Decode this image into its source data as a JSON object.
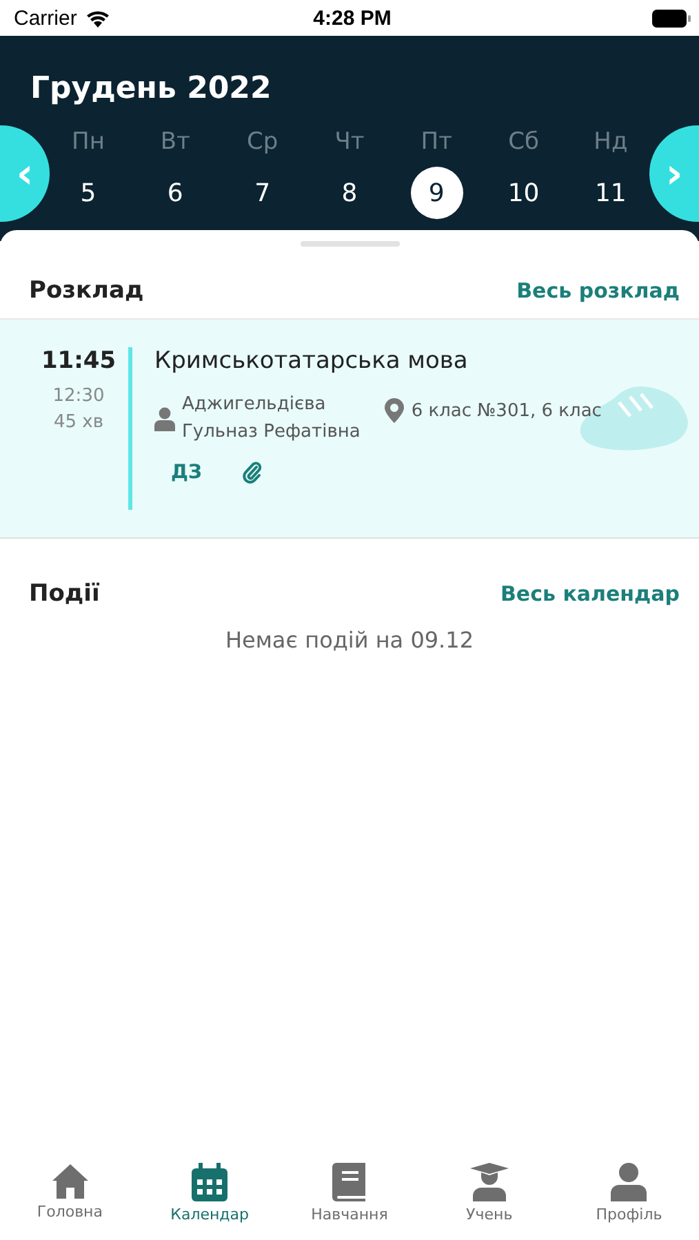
{
  "status_bar": {
    "carrier": "Carrier",
    "time": "4:28 PM"
  },
  "header": {
    "title": "Грудень 2022",
    "prev": "‹",
    "next": "›"
  },
  "days": [
    {
      "name": "Пн",
      "date": "5",
      "selected": false
    },
    {
      "name": "Вт",
      "date": "6",
      "selected": false
    },
    {
      "name": "Ср",
      "date": "7",
      "selected": false
    },
    {
      "name": "Чт",
      "date": "8",
      "selected": false
    },
    {
      "name": "Пт",
      "date": "9",
      "selected": true
    },
    {
      "name": "Сб",
      "date": "10",
      "selected": false
    },
    {
      "name": "Нд",
      "date": "11",
      "selected": false
    }
  ],
  "schedule": {
    "title": "Розклад",
    "link": "Весь розклад",
    "lessons": [
      {
        "start": "11:45",
        "end": "12:30",
        "duration": "45 хв",
        "subject": "Кримськотатарська мова",
        "teacher": "Аджигельдієва\nГульназ Рефатівна",
        "room": "6 клас  №301, 6 клас",
        "homework": "ДЗ",
        "attachment": true
      }
    ]
  },
  "events": {
    "title": "Події",
    "link": "Весь календар",
    "empty": "Немає подій на 09.12"
  },
  "tabs": [
    {
      "label": "Головна",
      "kind": "home",
      "selected": false
    },
    {
      "label": "Календар",
      "kind": "calendar",
      "selected": true
    },
    {
      "label": "Навчання",
      "kind": "book",
      "selected": false
    },
    {
      "label": "Учень",
      "kind": "student",
      "selected": false
    },
    {
      "label": "Профіль",
      "kind": "profile",
      "selected": false
    }
  ]
}
